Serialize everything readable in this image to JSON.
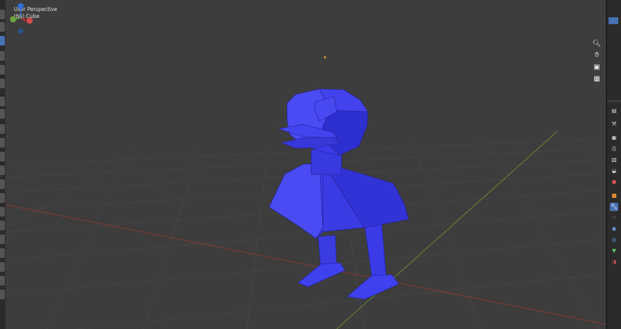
{
  "viewport": {
    "view_name": "User Perspective",
    "object_label": "(66) Cube"
  },
  "gizmo": {
    "z_label": "Z",
    "y_label": "Y",
    "x_label": "X"
  },
  "navigation": {
    "zoom_icon": "magnifier-icon",
    "pan_icon": "hand-icon",
    "camera_icon": "camera-icon",
    "ortho_icon": "grid-icon"
  },
  "toolbar": {
    "tools": [
      "select-box",
      "cursor",
      "move",
      "rotate",
      "scale",
      "transform",
      "annotate",
      "measure",
      "add-cube",
      "extrude",
      "inset",
      "bevel",
      "loop-cut",
      "knife",
      "poly-build",
      "spin",
      "smooth",
      "edge-slide",
      "shrink-fatten",
      "shear",
      "rip"
    ]
  },
  "properties_tabs": [
    "tool",
    "render",
    "output",
    "view-layer",
    "scene",
    "world",
    "object",
    "modifiers",
    "particles",
    "physics",
    "constraints",
    "data",
    "material",
    "texture"
  ],
  "colors": {
    "background": "#3d3d3d",
    "mesh": "#3b3ce8",
    "x_axis": "#c9443d",
    "y_axis": "#7da23a",
    "accent": "#4772b3"
  }
}
